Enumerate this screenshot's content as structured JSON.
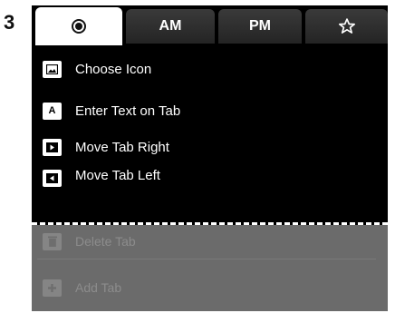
{
  "step_number": "3",
  "tabs": [
    {
      "label": "",
      "icon": "record-icon",
      "active": true
    },
    {
      "label": "AM",
      "active": false
    },
    {
      "label": "PM",
      "active": false
    },
    {
      "label": "",
      "icon": "star-icon",
      "active": false
    }
  ],
  "menu": {
    "items": [
      {
        "label": "Choose Icon",
        "icon": "image-icon"
      },
      {
        "label": "Enter Text on Tab",
        "icon_text": "A",
        "icon": "letter-a-icon"
      },
      {
        "label": "Move Tab Right",
        "icon": "move-right-icon"
      },
      {
        "label": "Move Tab Left",
        "icon": "move-left-icon"
      }
    ]
  },
  "nav": {
    "back_icon": "back-arrow-icon",
    "home_icon": "home-icon"
  },
  "lower": {
    "items": [
      {
        "label": "Delete Tab",
        "icon": "trash-icon",
        "enabled": false
      },
      {
        "label": "Add Tab",
        "icon": "plus-icon",
        "enabled": false
      }
    ]
  },
  "colors": {
    "background": "#000000",
    "active_tab": "#ffffff",
    "disabled_area": "#6b6b6b",
    "disabled_text": "#8c8c8c"
  }
}
